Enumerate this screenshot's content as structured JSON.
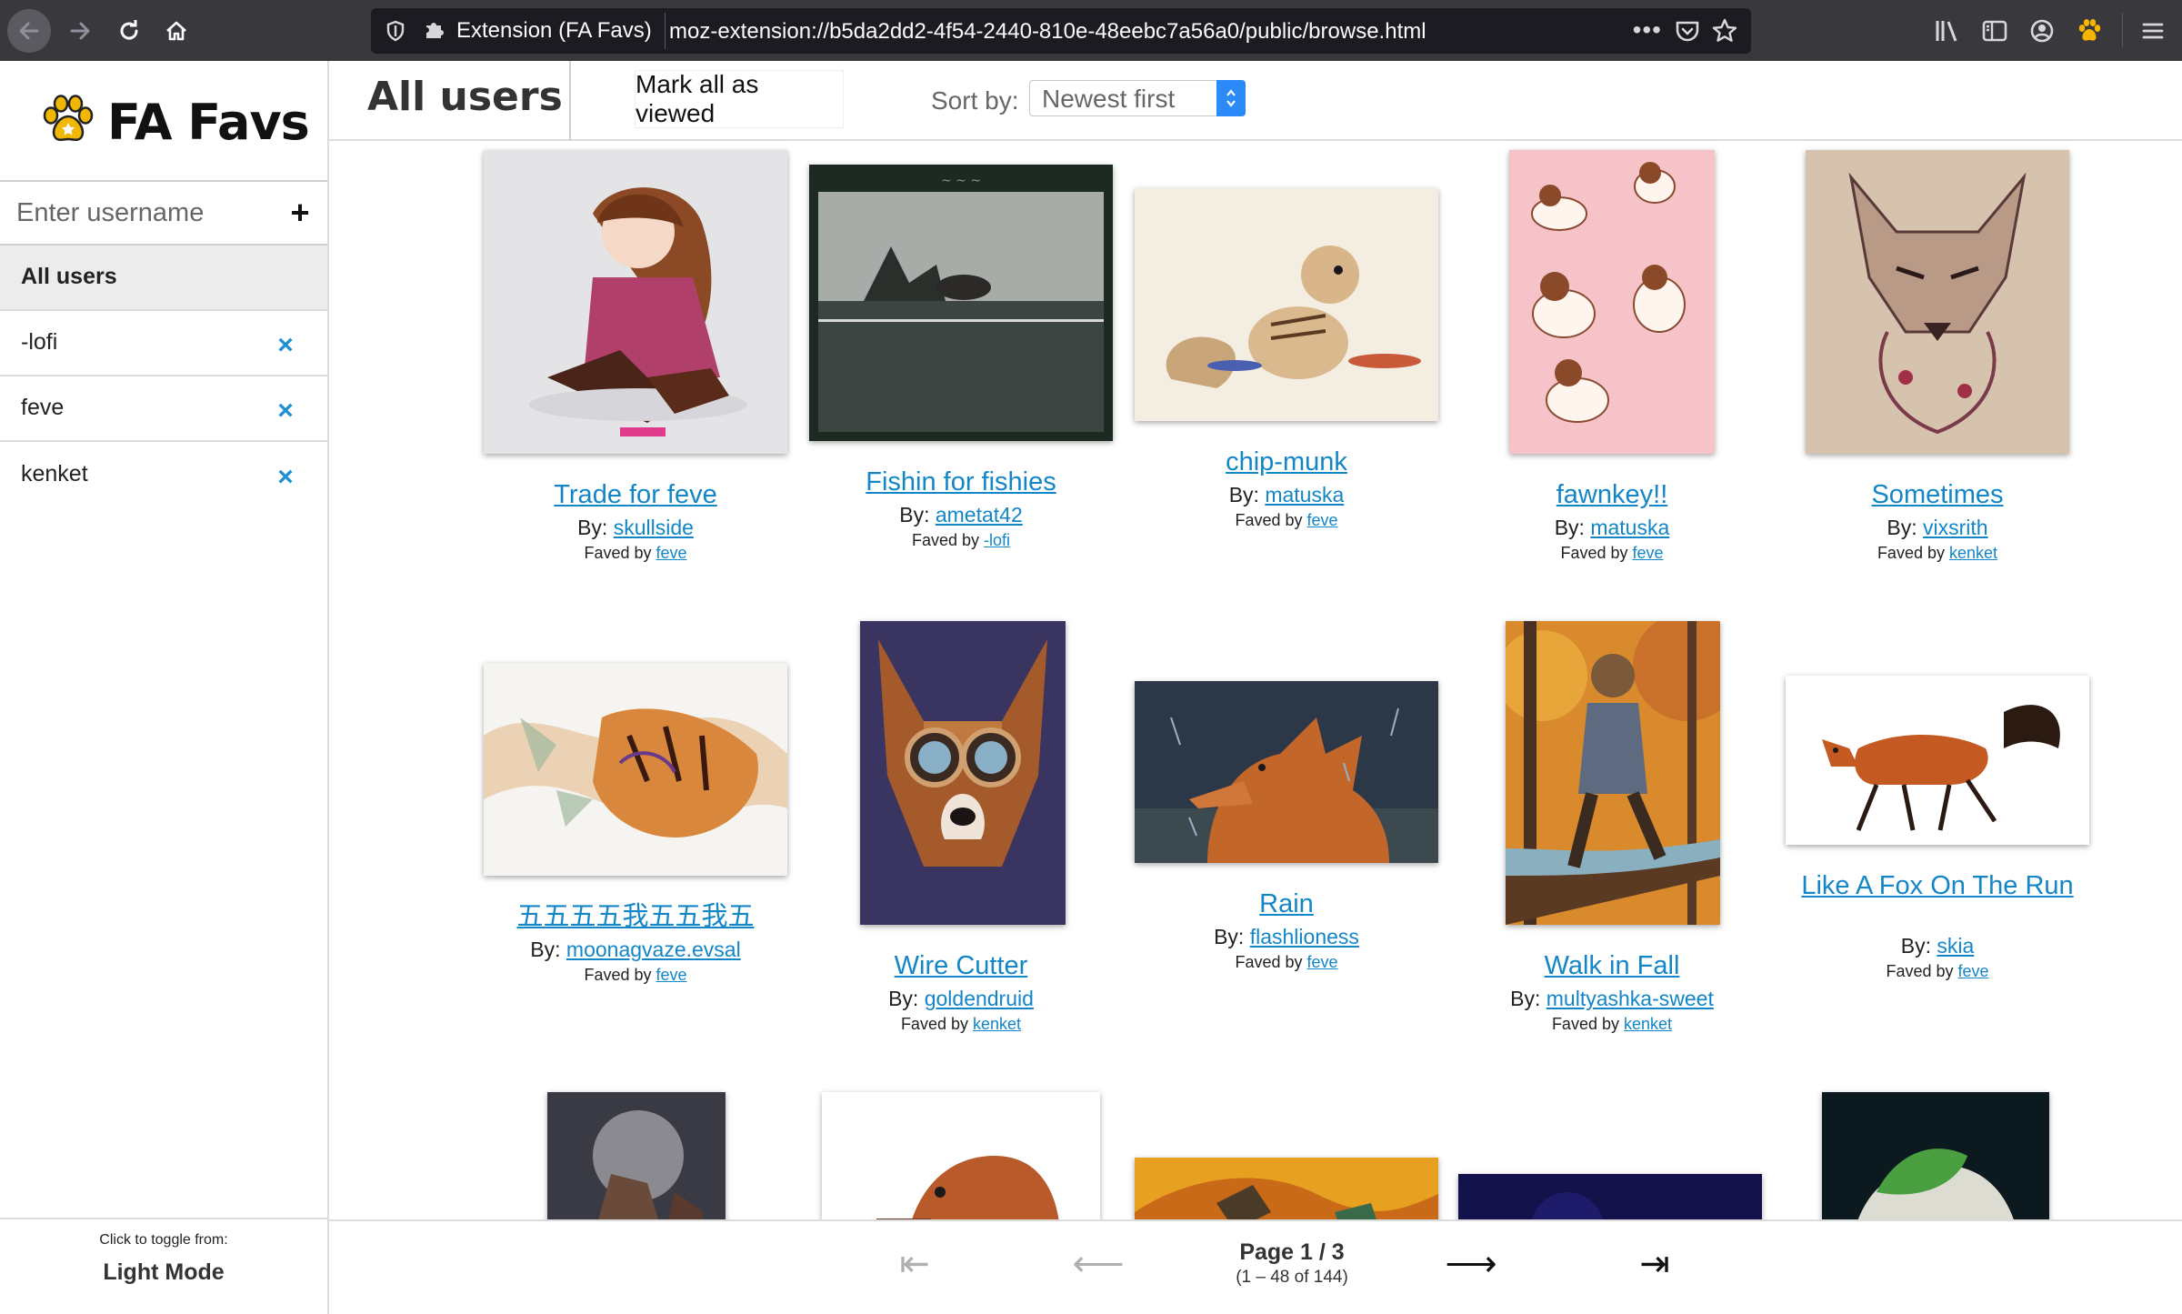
{
  "browser": {
    "extension_label": "Extension (FA Favs)",
    "url": "moz-extension://b5da2dd2-4f54-2440-810e-48eebc7a56a0/public/browse.html",
    "more_glyph": "•••",
    "icons": [
      "back-arrow-icon",
      "forward-arrow-icon",
      "reload-icon",
      "home-icon",
      "shield-icon",
      "puzzle-icon",
      "pocket-icon",
      "star-icon",
      "library-icon",
      "sidebar-icon",
      "account-icon",
      "paw-icon",
      "hamburger-menu-icon"
    ]
  },
  "sidebar": {
    "app_title": "FA Favs",
    "username_placeholder": "Enter username",
    "add_glyph": "+",
    "remove_glyph": "×",
    "users": [
      {
        "label": "All users",
        "selected": true
      },
      {
        "label": "-lofi"
      },
      {
        "label": "feve"
      },
      {
        "label": "kenket"
      }
    ],
    "theme_caption": "Click to toggle from:",
    "theme_value": "Light Mode"
  },
  "header": {
    "title": "All users",
    "mark_viewed": "Mark all as viewed",
    "sort_label": "Sort by:",
    "sort_value": "Newest first"
  },
  "labels": {
    "by": "By:",
    "faved_by": "Faved by"
  },
  "submissions": [
    {
      "title": "Trade for feve",
      "artist": "skullside",
      "faved_by": "feve"
    },
    {
      "title": "Fishin for fishies",
      "artist": "ametat42",
      "faved_by": "-lofi"
    },
    {
      "title": "chip-munk",
      "artist": "matuska",
      "faved_by": "feve"
    },
    {
      "title": "fawnkey!!",
      "artist": "matuska",
      "faved_by": "feve"
    },
    {
      "title": "Sometimes",
      "artist": "vixsrith",
      "faved_by": "kenket"
    },
    {
      "title": "五五五五我五五我五",
      "artist": "moonagvaze.evsal",
      "faved_by": "feve"
    },
    {
      "title": "Wire Cutter",
      "artist": "goldendruid",
      "faved_by": "kenket"
    },
    {
      "title": "Rain",
      "artist": "flashlioness",
      "faved_by": "feve"
    },
    {
      "title": "Walk in Fall",
      "artist": "multyashka-sweet",
      "faved_by": "kenket"
    },
    {
      "title": "Like A Fox On The Run",
      "artist": "skia",
      "faved_by": "feve"
    }
  ],
  "pagination": {
    "page": "Page 1 / 3",
    "range": "(1 – 48 of 144)",
    "first_glyph": "⇤",
    "prev_glyph": "⟵",
    "next_glyph": "⟶",
    "last_glyph": "⇥"
  }
}
